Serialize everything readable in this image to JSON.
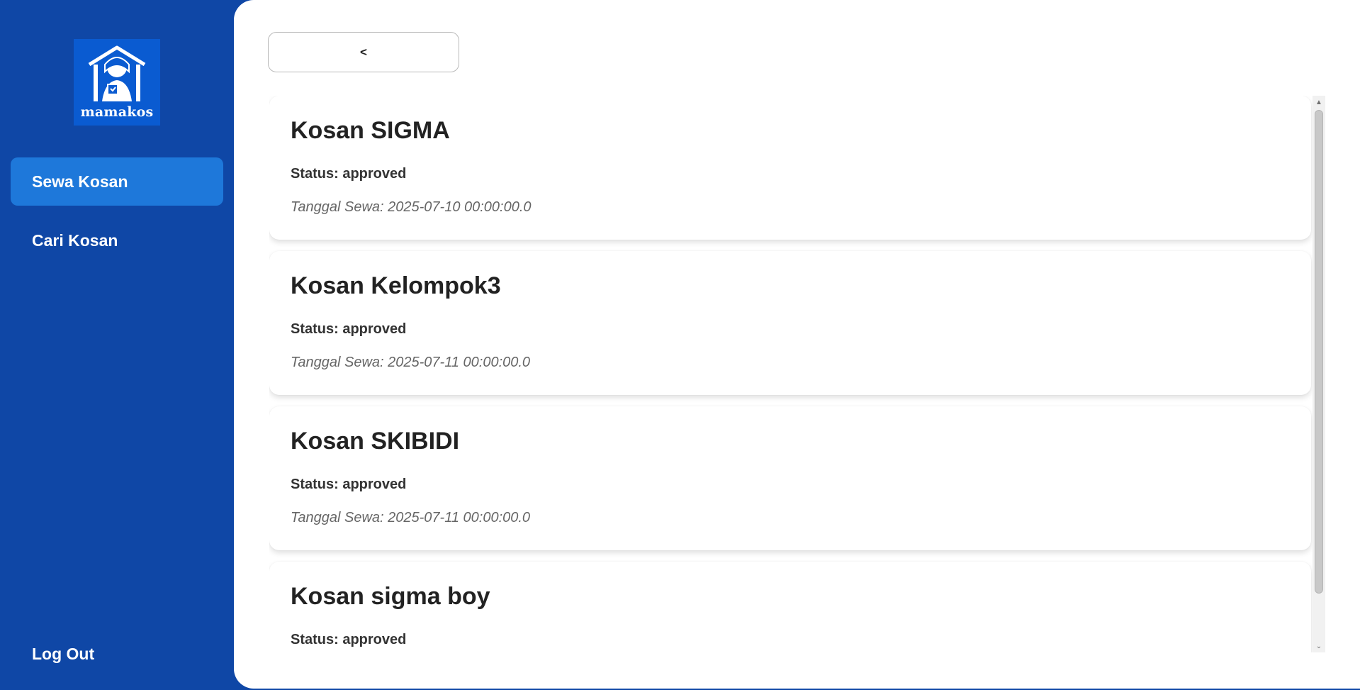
{
  "sidebar": {
    "logo_text": "mamakos",
    "items": [
      {
        "label": "Sewa Kosan"
      },
      {
        "label": "Cari Kosan"
      }
    ],
    "logout_label": "Log Out"
  },
  "main": {
    "back_label": "<",
    "bookings": [
      {
        "title": "Kosan SIGMA",
        "status": "Status: approved",
        "date": "Tanggal Sewa: 2025-07-10 00:00:00.0"
      },
      {
        "title": "Kosan Kelompok3",
        "status": "Status: approved",
        "date": "Tanggal Sewa: 2025-07-11 00:00:00.0"
      },
      {
        "title": "Kosan SKIBIDI",
        "status": "Status: approved",
        "date": "Tanggal Sewa: 2025-07-11 00:00:00.0"
      },
      {
        "title": "Kosan sigma boy",
        "status": "Status: approved",
        "date": ""
      }
    ]
  },
  "colors": {
    "sidebar_bg": "#0f47a6",
    "active_item": "#1e78da",
    "logo_bg": "#0a5bd1"
  },
  "icons": {
    "logo": "mamakos-logo",
    "scroll_up": "chevron-up-icon",
    "scroll_down": "chevron-down-icon"
  }
}
